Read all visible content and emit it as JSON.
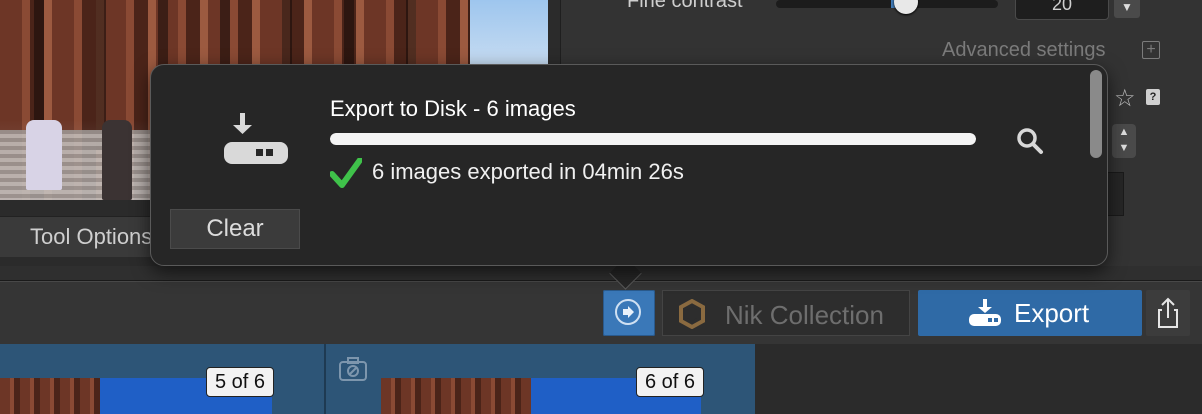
{
  "background": {
    "fine_contrast_label": "Fine contrast",
    "fine_contrast_value": "20",
    "advanced_settings_label": "Advanced settings",
    "help_label": "?",
    "tool_options_label": "Tool Options"
  },
  "toolbar": {
    "nik_collection_label": "Nik Collection",
    "export_label": "Export"
  },
  "filmstrip": {
    "badges": [
      "5 of 6",
      "6 of 6"
    ]
  },
  "popover": {
    "job_title": "Export to Disk - 6 images",
    "progress": 1.0,
    "status": "6 images exported in 04min 26s",
    "clear_label": "Clear"
  },
  "icons": {
    "disk": "export-to-disk-icon",
    "check": "checkmark-icon",
    "magnify": "magnifier-icon",
    "share": "share-icon",
    "camera": "camera-off-icon",
    "star": "star-icon",
    "action": "action-arrow-icon",
    "nik": "nik-logo-icon"
  },
  "colors": {
    "accent_blue": "#2f6aa6",
    "check_green": "#3fc24a",
    "popover_bg": "#262626"
  }
}
